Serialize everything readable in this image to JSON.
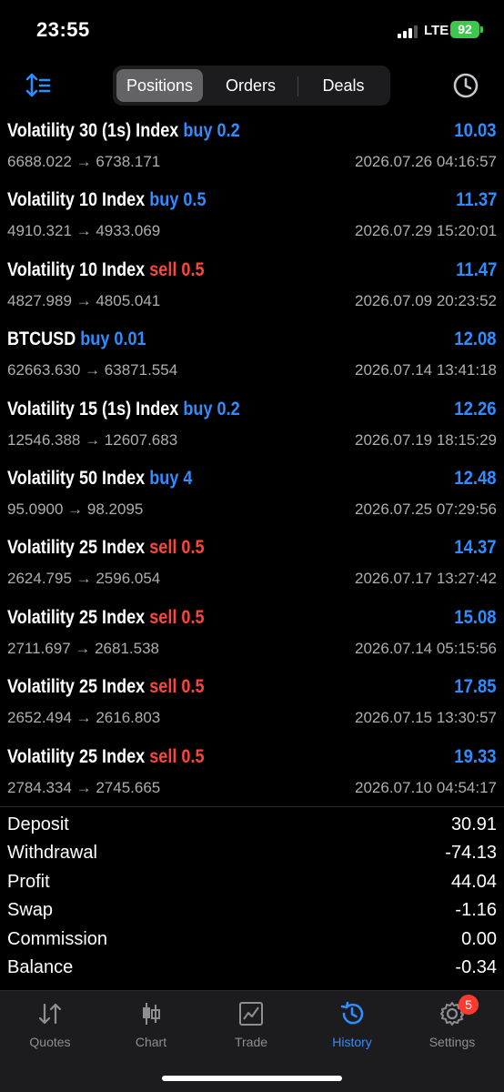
{
  "status": {
    "time": "23:55",
    "network": "LTE",
    "battery": "92",
    "battery_color": "#3ec64e"
  },
  "toolbar": {
    "sort_icon": "sort-icon",
    "tabs": [
      {
        "label": "Positions"
      },
      {
        "label": "Orders"
      },
      {
        "label": "Deals"
      }
    ],
    "active_tab": "Positions",
    "history_icon": "clock-icon"
  },
  "deals": [
    {
      "symbol": "Volatility 30 (1s) Index",
      "side": "buy",
      "volume": "0.2",
      "prices": "6688.022 → 6738.171",
      "time": "2026.07.26 04:16:57",
      "profit": "10.03"
    },
    {
      "symbol": "Volatility 10 Index",
      "side": "buy",
      "volume": "0.5",
      "prices": "4910.321 → 4933.069",
      "time": "2026.07.29 15:20:01",
      "profit": "11.37"
    },
    {
      "symbol": "Volatility 10 Index",
      "side": "sell",
      "volume": "0.5",
      "prices": "4827.989 → 4805.041",
      "time": "2026.07.09 20:23:52",
      "profit": "11.47"
    },
    {
      "symbol": "BTCUSD",
      "side": "buy",
      "volume": "0.01",
      "prices": "62663.630 → 63871.554",
      "time": "2026.07.14 13:41:18",
      "profit": "12.08"
    },
    {
      "symbol": "Volatility 15 (1s) Index",
      "side": "buy",
      "volume": "0.2",
      "prices": "12546.388 → 12607.683",
      "time": "2026.07.19 18:15:29",
      "profit": "12.26"
    },
    {
      "symbol": "Volatility 50 Index",
      "side": "buy",
      "volume": "4",
      "prices": "95.0900 → 98.2095",
      "time": "2026.07.25 07:29:56",
      "profit": "12.48"
    },
    {
      "symbol": "Volatility 25 Index",
      "side": "sell",
      "volume": "0.5",
      "prices": "2624.795 → 2596.054",
      "time": "2026.07.17 13:27:42",
      "profit": "14.37"
    },
    {
      "symbol": "Volatility 25 Index",
      "side": "sell",
      "volume": "0.5",
      "prices": "2711.697 → 2681.538",
      "time": "2026.07.14 05:15:56",
      "profit": "15.08"
    },
    {
      "symbol": "Volatility 25 Index",
      "side": "sell",
      "volume": "0.5",
      "prices": "2652.494 → 2616.803",
      "time": "2026.07.15 13:30:57",
      "profit": "17.85"
    },
    {
      "symbol": "Volatility 25 Index",
      "side": "sell",
      "volume": "0.5",
      "prices": "2784.334 → 2745.665",
      "time": "2026.07.10 04:54:17",
      "profit": "19.33"
    }
  ],
  "summary": [
    {
      "label": "Deposit",
      "value": "30.91"
    },
    {
      "label": "Withdrawal",
      "value": "-74.13"
    },
    {
      "label": "Profit",
      "value": "44.04"
    },
    {
      "label": "Swap",
      "value": "-1.16"
    },
    {
      "label": "Commission",
      "value": "0.00"
    },
    {
      "label": "Balance",
      "value": "-0.34"
    }
  ],
  "tabbar": [
    {
      "label": "Quotes",
      "icon": "quotes-icon"
    },
    {
      "label": "Chart",
      "icon": "chart-icon"
    },
    {
      "label": "Trade",
      "icon": "trade-icon"
    },
    {
      "label": "History",
      "icon": "history-icon"
    },
    {
      "label": "Settings",
      "icon": "gear-icon",
      "badge": "5"
    }
  ],
  "active_tab": "History",
  "colors": {
    "buy": "#2f8dff",
    "sell": "#ff453a",
    "accent": "#2f8dff",
    "badge": "#ff3b30"
  }
}
